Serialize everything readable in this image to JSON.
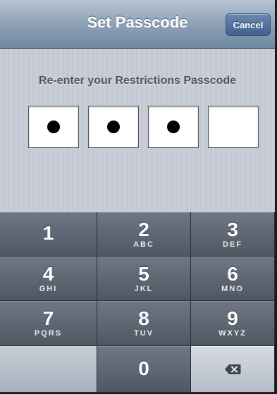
{
  "navbar": {
    "title": "Set Passcode",
    "cancel_label": "Cancel"
  },
  "prompt": "Re-enter your Restrictions Passcode",
  "passcode": {
    "total_digits": 4,
    "entered_digits": 3
  },
  "keypad": {
    "keys": [
      {
        "digit": "1",
        "letters": ""
      },
      {
        "digit": "2",
        "letters": "ABC"
      },
      {
        "digit": "3",
        "letters": "DEF"
      },
      {
        "digit": "4",
        "letters": "GHI"
      },
      {
        "digit": "5",
        "letters": "JKL"
      },
      {
        "digit": "6",
        "letters": "MNO"
      },
      {
        "digit": "7",
        "letters": "PQRS"
      },
      {
        "digit": "8",
        "letters": "TUV"
      },
      {
        "digit": "9",
        "letters": "WXYZ"
      },
      {
        "digit": "0",
        "letters": ""
      }
    ],
    "delete_icon": "backspace-icon"
  },
  "colors": {
    "navbar": "#8ea2b8",
    "cancel_button": "#4f6f9e",
    "keypad": "#5a626e"
  }
}
